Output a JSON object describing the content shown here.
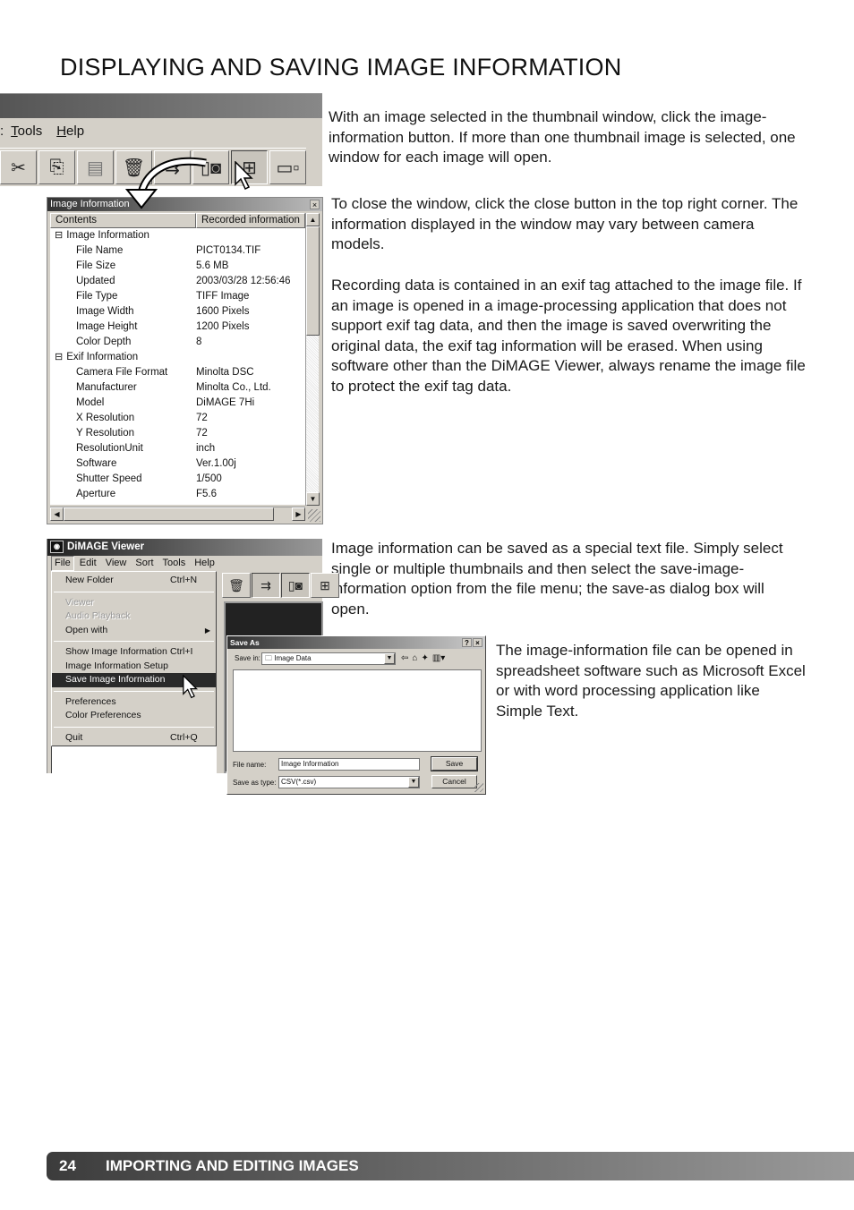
{
  "page": {
    "title": "DISPLAYING AND SAVING IMAGE INFORMATION",
    "paragraphs": [
      "With an image selected in the thumbnail window, click the image-information button. If more than one thumbnail image is selected, one window for each image will open.",
      "To close the window, click the close button in the top right corner. The information displayed in the window may vary between camera models.",
      "Recording data is contained in an exif tag attached to the image file. If an image is opened in a image-processing application that does not support exif tag data, and then the image is saved overwriting the original data, the exif tag information will be erased. When using software other than the DiMAGE Viewer, always rename the image file to protect the exif tag data.",
      "Image information can be saved as a special text file. Simply select single or multiple thumbnails and then select the save-image-information option from the file menu; the save-as dialog box will open.",
      "The image-information file can be opened in spreadsheet software such as Microsoft Excel or with word processing application like Simple Text."
    ],
    "footer": {
      "page_number": "24",
      "section": "IMPORTING AND EDITING IMAGES"
    }
  },
  "toolbar_screenshot": {
    "menu": [
      {
        "label": "Tools",
        "accel": "T",
        "rest": "ools"
      },
      {
        "label": "Help",
        "accel": "H",
        "rest": "elp"
      }
    ],
    "buttons": [
      "scissors-icon",
      "copy-icon",
      "paste-icon",
      "delete-icon",
      "move-icon",
      "image-information-icon",
      "thumbnail-grid-icon",
      "thumbnail-detail-icon"
    ]
  },
  "image_info_window": {
    "title": "Image Information",
    "close": "×",
    "columns": [
      "Contents",
      "Recorded information"
    ],
    "groups": [
      {
        "name": "Image Information",
        "rows": [
          {
            "k": "File Name",
            "v": "PICT0134.TIF"
          },
          {
            "k": "File Size",
            "v": "5.6 MB"
          },
          {
            "k": "Updated",
            "v": "2003/03/28 12:56:46"
          },
          {
            "k": "File Type",
            "v": "TIFF Image"
          },
          {
            "k": "Image Width",
            "v": "1600 Pixels"
          },
          {
            "k": "Image Height",
            "v": "1200 Pixels"
          },
          {
            "k": "Color Depth",
            "v": "8"
          }
        ]
      },
      {
        "name": "Exif Information",
        "rows": [
          {
            "k": "Camera File Format",
            "v": "Minolta DSC"
          },
          {
            "k": "Manufacturer",
            "v": "Minolta Co., Ltd."
          },
          {
            "k": "Model",
            "v": "DiMAGE 7Hi"
          },
          {
            "k": "X Resolution",
            "v": "72"
          },
          {
            "k": "Y Resolution",
            "v": "72"
          },
          {
            "k": "ResolutionUnit",
            "v": "inch"
          },
          {
            "k": "Software",
            "v": "Ver.1.00j"
          },
          {
            "k": "Shutter Speed",
            "v": "1/500"
          },
          {
            "k": "Aperture",
            "v": "F5.6"
          }
        ]
      }
    ]
  },
  "dimage_viewer": {
    "title": "DiMAGE Viewer",
    "menu": [
      "File",
      "Edit",
      "View",
      "Sort",
      "Tools",
      "Help"
    ],
    "file_menu": [
      {
        "label": "New Folder",
        "shortcut": "Ctrl+N"
      },
      {
        "sep": true
      },
      {
        "label": "Viewer",
        "disabled": true
      },
      {
        "label": "Audio Playback",
        "disabled": true
      },
      {
        "label": "Open with",
        "submenu": true
      },
      {
        "sep": true
      },
      {
        "label": "Show Image Information",
        "shortcut": "Ctrl+I"
      },
      {
        "label": "Image Information Setup"
      },
      {
        "label": "Save Image Information",
        "selected": true
      },
      {
        "sep": true
      },
      {
        "label": "Preferences"
      },
      {
        "label": "Color Preferences"
      },
      {
        "sep": true
      },
      {
        "label": "Quit",
        "shortcut": "Ctrl+Q"
      }
    ]
  },
  "save_as_dialog": {
    "title": "Save As",
    "help": "?",
    "close": "×",
    "save_in_label": "Save in:",
    "save_in_value": "Image Data",
    "file_name_label": "File name:",
    "file_name_value": "Image Information",
    "save_type_label": "Save as type:",
    "save_type_value": "CSV(*.csv)",
    "save_button": "Save",
    "cancel_button": "Cancel"
  }
}
